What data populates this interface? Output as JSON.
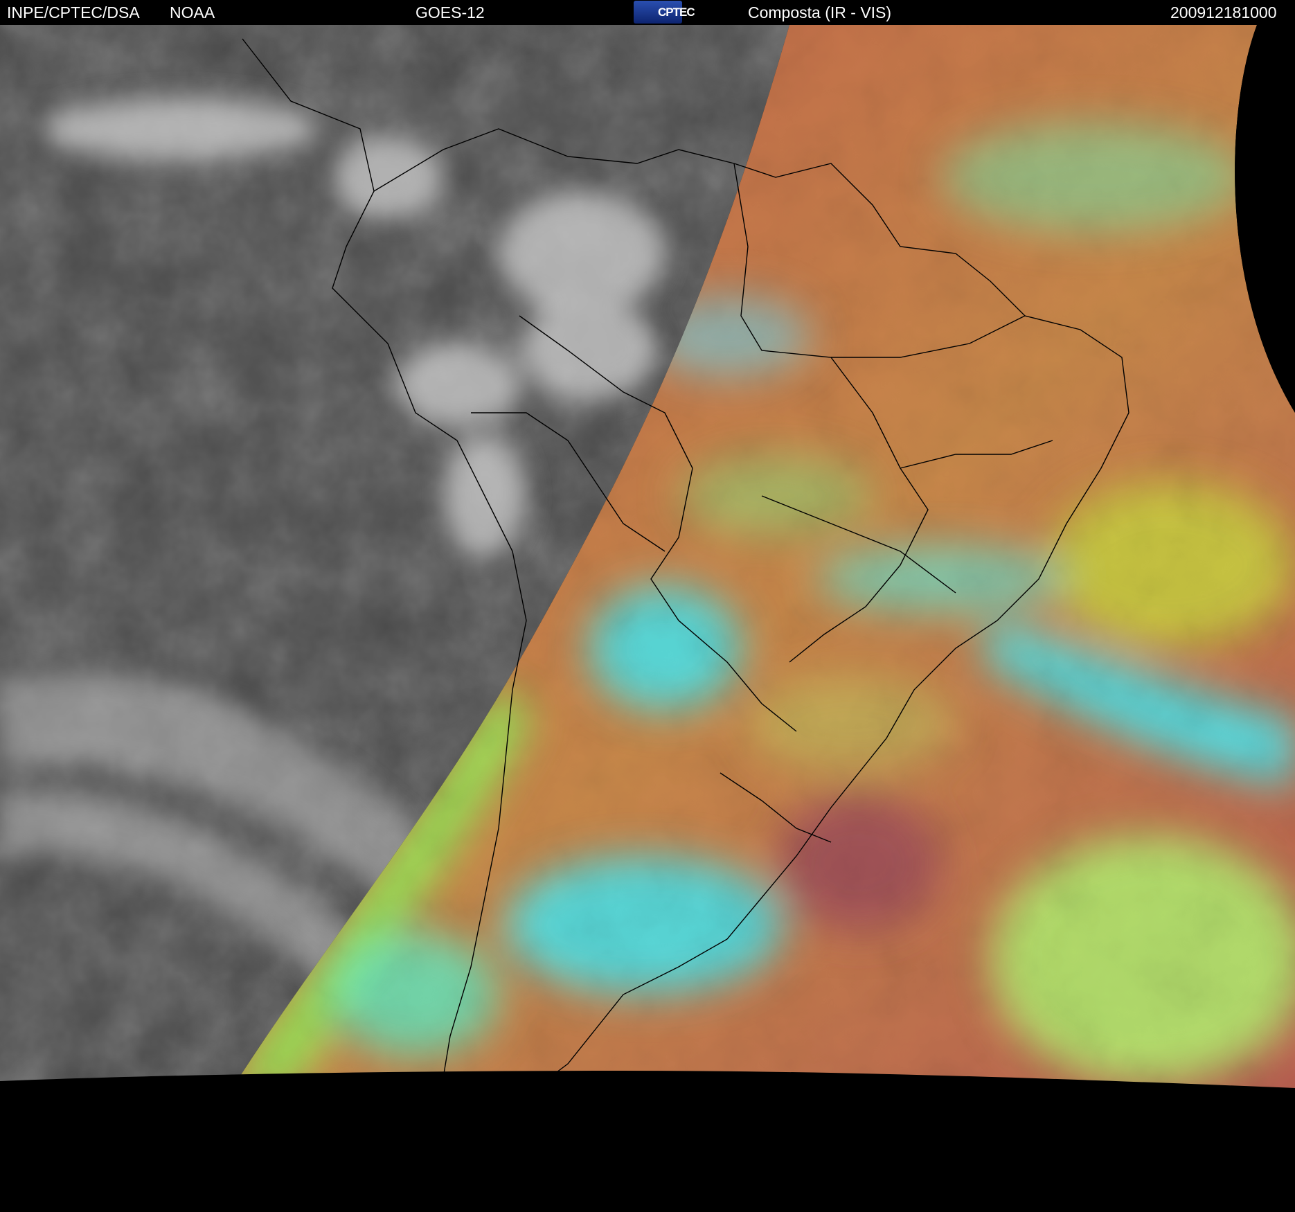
{
  "header": {
    "organization": "INPE/CPTEC/DSA",
    "agency": "NOAA",
    "satellite": "GOES-12",
    "logo_text": "CPTEC",
    "product": "Composta (IR - VIS)",
    "timestamp": "200912181000"
  },
  "colors": {
    "header_bg": "#000000",
    "header_text": "#ffffff",
    "space": "#000000",
    "night_ir_gray": "#4a4a4a",
    "land_red": "#b5524a",
    "cloud_cyan": "#3fe8f0",
    "cloud_green": "#8ff55a",
    "ocean_yellow": "#c8c040",
    "border_lines": "#000000"
  },
  "icons": {
    "logo": "cptec-logo-icon"
  }
}
